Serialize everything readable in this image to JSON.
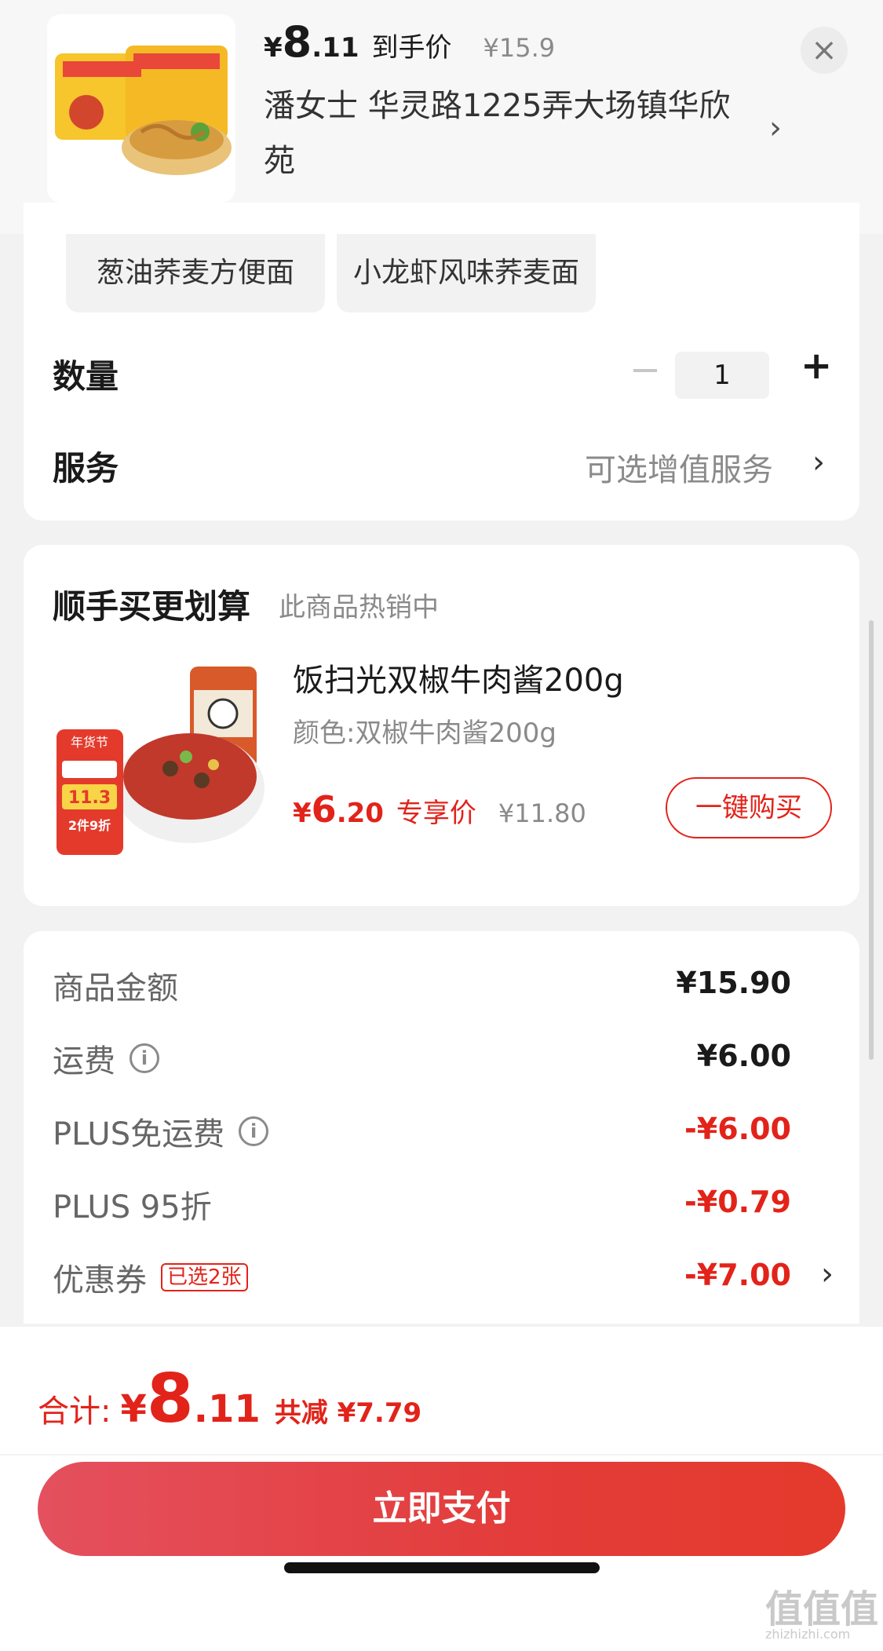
{
  "header": {
    "price_yen": "¥",
    "price_int": "8",
    "price_dec": ".11",
    "price_label": "到手价",
    "original_price": "¥15.9",
    "address": "潘女士  华灵路1225弄大场镇华欣苑",
    "arrow": "›",
    "close_icon": "×"
  },
  "variants": {
    "chip1": "葱油荞麦方便面",
    "chip2": "小龙虾风味荞麦面"
  },
  "quantity": {
    "label": "数量",
    "minus": "−",
    "value": "1",
    "plus": "+"
  },
  "service": {
    "label": "服务",
    "hint": "可选增值服务",
    "arrow": "›"
  },
  "recommend": {
    "title": "顺手买更划算",
    "subtitle": "此商品热销中",
    "product_name": "饭扫光双椒牛肉酱200g",
    "spec": "颜色:双椒牛肉酱200g",
    "price_yen": "¥",
    "price_int": "6",
    "price_dec": ".20",
    "price_label": "专享价",
    "original_price": "¥11.80",
    "buy_button": "一键购买",
    "image_badge_title": "年货节",
    "image_badge_price": "11.3",
    "image_badge_discount": "2件9折"
  },
  "fees": {
    "goods_label": "商品金额",
    "goods_value": "¥15.90",
    "shipping_label": "运费",
    "shipping_value": "¥6.00",
    "plus_free_label": "PLUS免运费",
    "plus_free_value": "-¥6.00",
    "plus_discount_label": "PLUS 95折",
    "plus_discount_value": "-¥0.79",
    "coupon_label": "优惠券",
    "coupon_tag": "已选2张",
    "coupon_value": "-¥7.00",
    "arrow": "›",
    "info_icon": "i"
  },
  "footer": {
    "total_label": "合计:",
    "total_yen": "¥",
    "total_int": "8",
    "total_dec": ".11",
    "saved": "共减 ¥7.79",
    "pay_button": "立即支付"
  },
  "watermark": {
    "main": "值值值",
    "sub": "zhizhizhi.com"
  },
  "colors": {
    "accent_red": "#e2231a",
    "pay_gradient_start": "#e4505e",
    "pay_gradient_end": "#e43a2c"
  }
}
